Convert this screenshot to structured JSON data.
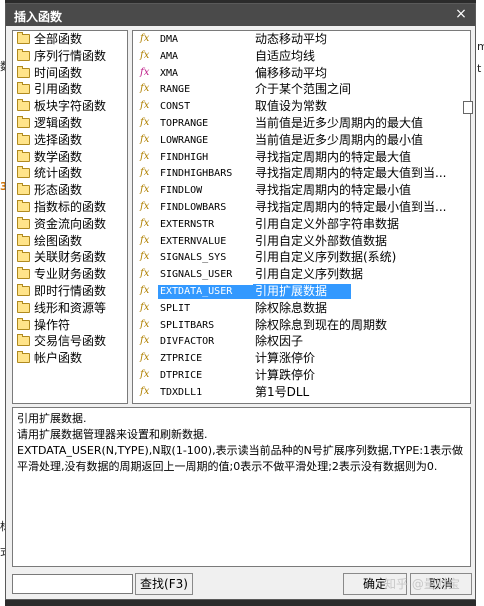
{
  "background": {
    "left_chars": [
      "数",
      "3",
      "标",
      "式"
    ],
    "right_chars": [
      "m",
      "t"
    ]
  },
  "dialog": {
    "title": "插入函数",
    "close_glyph": "×"
  },
  "categories": [
    "全部函数",
    "序列行情函数",
    "时间函数",
    "引用函数",
    "板块字符函数",
    "逻辑函数",
    "选择函数",
    "数学函数",
    "统计函数",
    "形态函数",
    "指数标的函数",
    "资金流向函数",
    "绘图函数",
    "关联财务函数",
    "专业财务函数",
    "即时行情函数",
    "线形和资源等",
    "操作符",
    "交易信号函数",
    "帐户函数"
  ],
  "functions": [
    {
      "name": "DMA",
      "desc": "动态移动平均",
      "icon_color": "gold"
    },
    {
      "name": "AMA",
      "desc": "自适应均线",
      "icon_color": "gold"
    },
    {
      "name": "XMA",
      "desc": "偏移移动平均",
      "icon_color": "pink"
    },
    {
      "name": "RANGE",
      "desc": "介于某个范围之间",
      "icon_color": "gold"
    },
    {
      "name": "CONST",
      "desc": "取值设为常数",
      "icon_color": "gold"
    },
    {
      "name": "TOPRANGE",
      "desc": "当前值是近多少周期内的最大值",
      "icon_color": "gold"
    },
    {
      "name": "LOWRANGE",
      "desc": "当前值是近多少周期内的最小值",
      "icon_color": "gold"
    },
    {
      "name": "FINDHIGH",
      "desc": "寻找指定周期内的特定最大值",
      "icon_color": "gold"
    },
    {
      "name": "FINDHIGHBARS",
      "desc": "寻找指定周期内的特定最大值到当...",
      "icon_color": "gold"
    },
    {
      "name": "FINDLOW",
      "desc": "寻找指定周期内的特定最小值",
      "icon_color": "gold"
    },
    {
      "name": "FINDLOWBARS",
      "desc": "寻找指定周期内的特定最小值到当...",
      "icon_color": "gold"
    },
    {
      "name": "EXTERNSTR",
      "desc": "引用自定义外部字符串数据",
      "icon_color": "gold"
    },
    {
      "name": "EXTERNVALUE",
      "desc": "引用自定义外部数值数据",
      "icon_color": "gold"
    },
    {
      "name": "SIGNALS_SYS",
      "desc": "引用自定义序列数据(系统)",
      "icon_color": "gold"
    },
    {
      "name": "SIGNALS_USER",
      "desc": "引用自定义序列数据",
      "icon_color": "gold"
    },
    {
      "name": "EXTDATA_USER",
      "desc": "引用扩展数据",
      "icon_color": "gold",
      "selected": true
    },
    {
      "name": "SPLIT",
      "desc": "除权除息数据",
      "icon_color": "gold"
    },
    {
      "name": "SPLITBARS",
      "desc": "除权除息到现在的周期数",
      "icon_color": "gold"
    },
    {
      "name": "DIVFACTOR",
      "desc": "除权因子",
      "icon_color": "gold"
    },
    {
      "name": "ZTPRICE",
      "desc": "计算涨停价",
      "icon_color": "gold"
    },
    {
      "name": "DTPRICE",
      "desc": "计算跌停价",
      "icon_color": "gold"
    },
    {
      "name": "TDXDLL1",
      "desc": "第1号DLL",
      "icon_color": "gold"
    }
  ],
  "description": {
    "lines": [
      "引用扩展数据.",
      "请用扩展数据管理器来设置和刷新数据.",
      "EXTDATA_USER(N,TYPE),N取(1-100),表示读当前品种的N号扩展序列数据,TYPE:1表示做平滑处理,没有数据的周期返回上一周期的值;0表示不做平滑处理;2表示没有数据则为0."
    ]
  },
  "search": {
    "value": "",
    "button_label": "查找(F3)"
  },
  "ok_button": "确定",
  "cancel_button": "取消",
  "watermark": "知乎 @量财宝",
  "icon_glyph": "fx"
}
